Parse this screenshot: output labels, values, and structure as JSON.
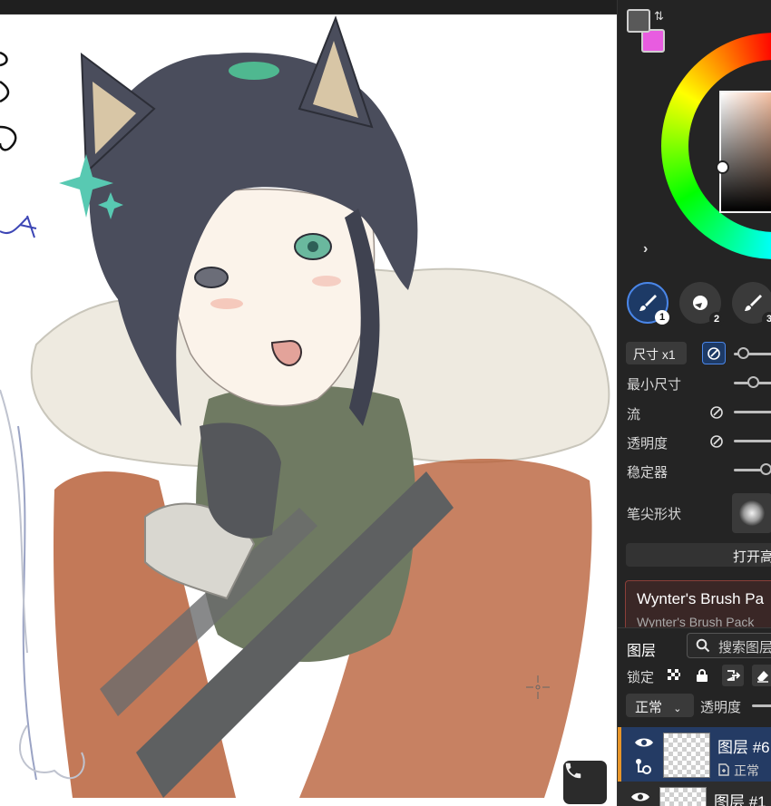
{
  "canvas": {
    "background": "#ffffff",
    "call_button_icon": "phone-icon"
  },
  "colors": {
    "foreground": "#595959",
    "background": "#e85ce0",
    "accent": "#4a86e8",
    "selected_layer_marker": "#e8962a"
  },
  "color_panel": {
    "swap_icon": "swap-arrows-icon",
    "expand_icon": "chevron-right-icon"
  },
  "brushes": [
    {
      "number": "1",
      "active": true
    },
    {
      "number": "2",
      "active": false
    },
    {
      "number": "3",
      "active": false
    }
  ],
  "brush_settings": {
    "size_label": "尺寸 x1",
    "min_size_label": "最小尺寸",
    "flow_label": "流",
    "opacity_label": "透明度",
    "stabilizer_label": "稳定器",
    "tip_shape_label": "笔尖形状",
    "open_button_label": "打开高"
  },
  "brush_pack": {
    "title": "Wynter's Brush Pa",
    "subtitle": "Wynter's Brush Pack"
  },
  "layers_panel": {
    "title": "图层",
    "search_placeholder": "搜索图层",
    "lock_label": "锁定",
    "blend_mode": "正常",
    "opacity_label": "透明度",
    "layers": [
      {
        "name": "图层 #6",
        "mode": "正常",
        "selected": true
      },
      {
        "name": "图层 #1",
        "mode": "",
        "selected": false
      }
    ]
  }
}
